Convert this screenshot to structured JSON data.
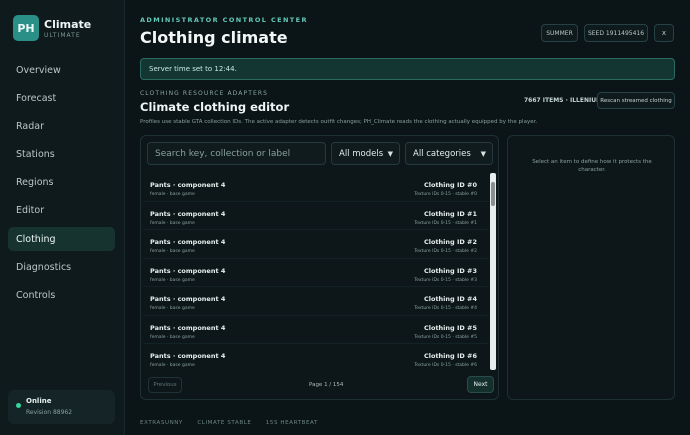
{
  "brand": {
    "logo": "PH",
    "name": "Climate",
    "subtitle": "ULTIMATE"
  },
  "nav": [
    "Overview",
    "Forecast",
    "Radar",
    "Stations",
    "Regions",
    "Editor",
    "Clothing",
    "Diagnostics",
    "Controls"
  ],
  "nav_active": "Clothing",
  "status": {
    "title": "Online",
    "revision": "Revision 88962"
  },
  "header": {
    "eyebrow": "ADMINISTRATOR CONTROL CENTER",
    "title": "Clothing climate",
    "season_chip": "SUMMER",
    "seed_chip": "SEED 1911495416",
    "close_label": "x"
  },
  "banner": "Server time set to 12:44.",
  "section": {
    "eyebrow": "CLOTHING RESOURCE ADAPTERS",
    "title": "Climate clothing editor",
    "description": "Profiles use stable GTA collection IDs. The active adapter detects outfit changes; PH_Climate reads the clothing actually equipped by the player.",
    "items_count": "7667 ITEMS · ILLENIUM",
    "rescan_label": "Rescan streamed clothing"
  },
  "filters": {
    "search_placeholder": "Search key, collection or label",
    "model_select": "All models",
    "category_select": "All categories"
  },
  "items": [
    {
      "title": "Pants · component 4",
      "sub": "female · base game",
      "id": "Clothing ID #0",
      "tex": "Texture IDs 0-15 · stable #0"
    },
    {
      "title": "Pants · component 4",
      "sub": "female · base game",
      "id": "Clothing ID #1",
      "tex": "Texture IDs 0-15 · stable #1"
    },
    {
      "title": "Pants · component 4",
      "sub": "female · base game",
      "id": "Clothing ID #2",
      "tex": "Texture IDs 0-15 · stable #2"
    },
    {
      "title": "Pants · component 4",
      "sub": "female · base game",
      "id": "Clothing ID #3",
      "tex": "Texture IDs 0-15 · stable #3"
    },
    {
      "title": "Pants · component 4",
      "sub": "female · base game",
      "id": "Clothing ID #4",
      "tex": "Texture IDs 0-15 · stable #4"
    },
    {
      "title": "Pants · component 4",
      "sub": "female · base game",
      "id": "Clothing ID #5",
      "tex": "Texture IDs 0-15 · stable #5"
    },
    {
      "title": "Pants · component 4",
      "sub": "female · base game",
      "id": "Clothing ID #6",
      "tex": "Texture IDs 0-15 · stable #6"
    }
  ],
  "pagination": {
    "prev": "Previous",
    "page": "Page 1 / 154",
    "next": "Next"
  },
  "detail_hint": "Select an item to define how it protects the character.",
  "footer": [
    "EXTRASUNNY",
    "CLIMATE STABLE",
    "15S HEARTBEAT"
  ],
  "colors": {
    "accent": "#2a8f86",
    "online": "#37d39b",
    "background": "#0b1416"
  }
}
